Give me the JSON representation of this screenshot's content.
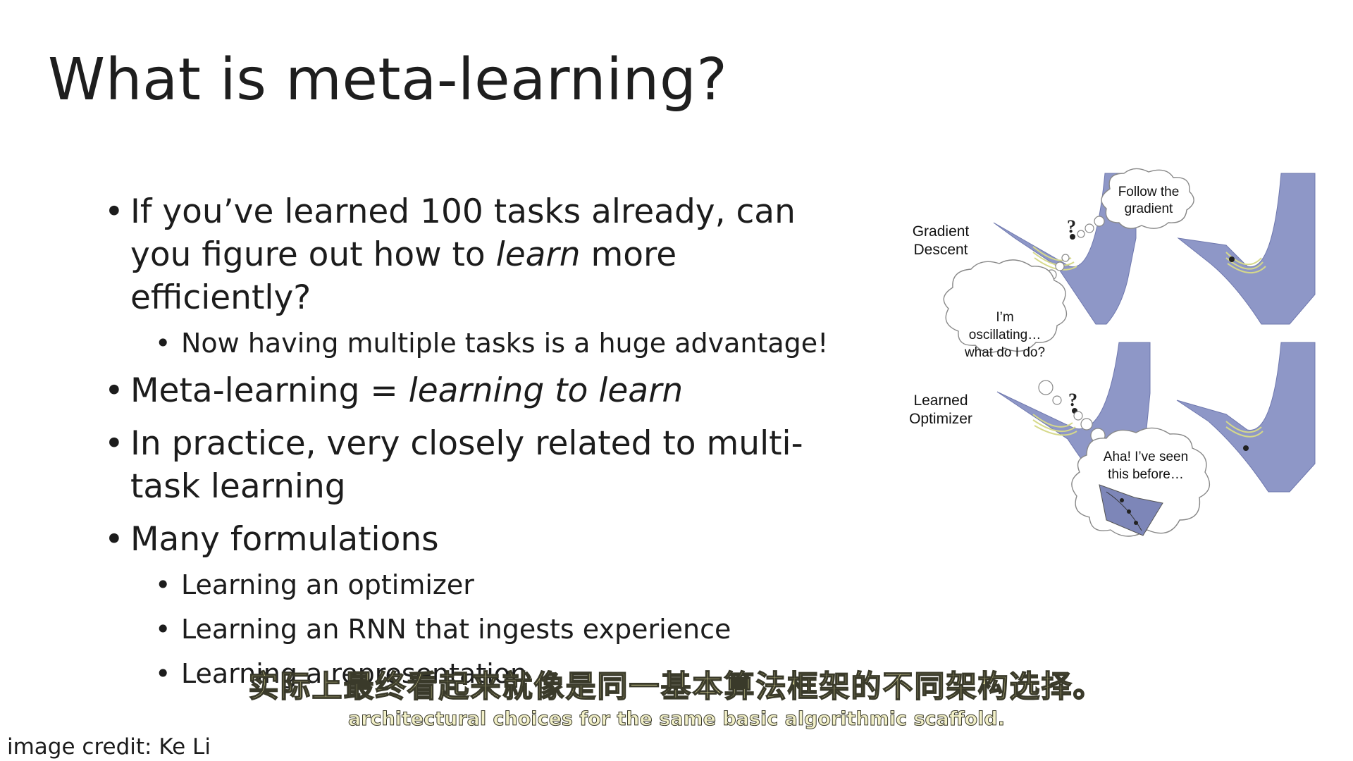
{
  "slide": {
    "title": "What is meta-learning?",
    "bullets": {
      "b1_a": "If you’ve learned 100 tasks already, can you figure out how to ",
      "b1_em": "learn",
      "b1_b": " more efficiently?",
      "b1_sub": "Now having multiple tasks is a huge advantage!",
      "b2_a": "Meta-learning = ",
      "b2_em": "learning to learn",
      "b3": "In practice, very closely related to multi-task learning",
      "b4": "Many formulations",
      "b4_subs": [
        "Learning an optimizer",
        "Learning an RNN that ingests experience",
        "Learning a representation"
      ]
    },
    "figure": {
      "label_gd_1": "Gradient",
      "label_gd_2": "Descent",
      "label_lo_1": "Learned",
      "label_lo_2": "Optimizer",
      "cloud_follow_1": "Follow the",
      "cloud_follow_2": "gradient",
      "cloud_osc_1": "I’m",
      "cloud_osc_2": "oscillating…",
      "cloud_osc_3": "what do I do?",
      "cloud_aha_1": "Aha! I’ve seen",
      "cloud_aha_2": "this before…",
      "colors": {
        "valley": "#8e97c7",
        "valley_edge": "#6f78ae",
        "trajectory": "#d6d98a"
      }
    },
    "credit": "image credit: Ke Li"
  },
  "subtitles": {
    "cn": "实际上最终看起来就像是同一基本算法框架的不同架构选择。",
    "en": "architectural choices for the same basic algorithmic scaffold."
  }
}
